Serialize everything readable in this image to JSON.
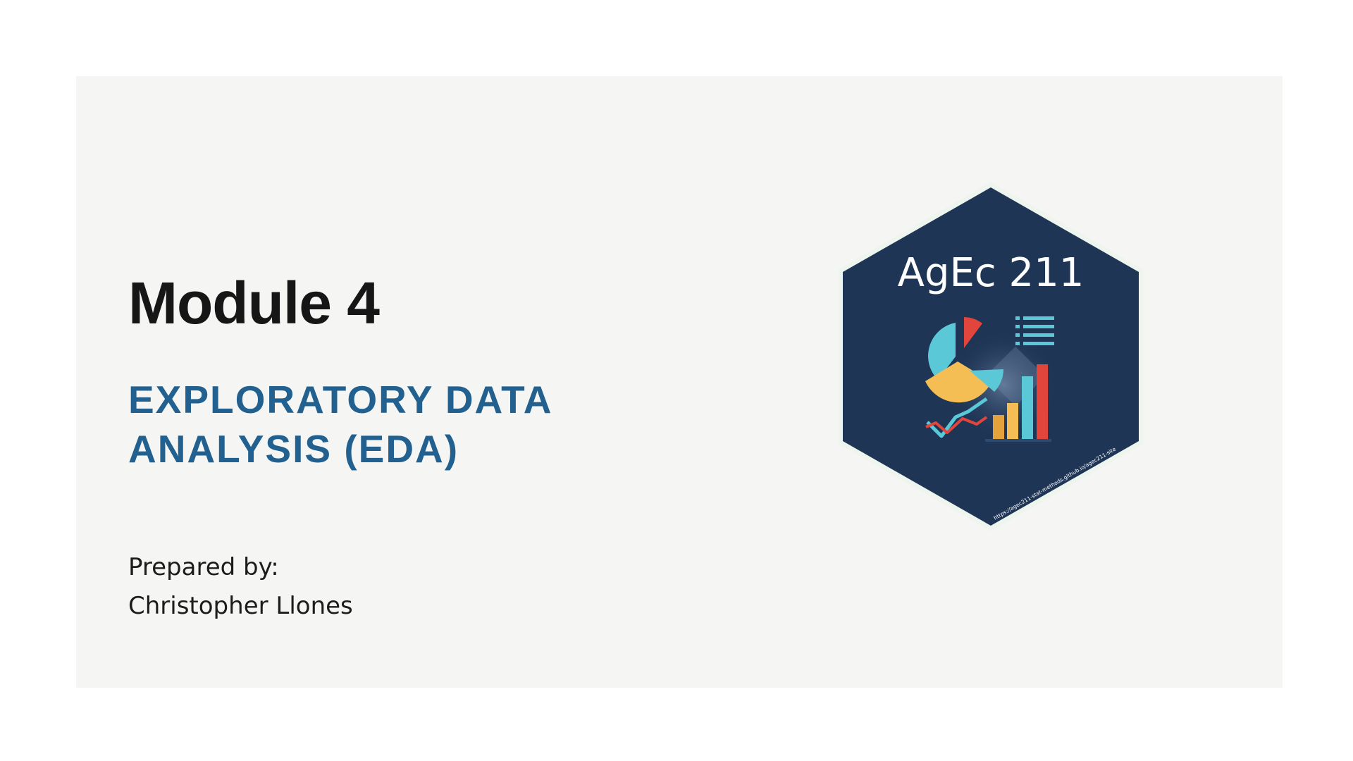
{
  "slide": {
    "title": "Module 4",
    "subtitle": "EXPLORATORY DATA ANALYSIS (EDA)",
    "prepared_label": "Prepared by:",
    "author": "Christopher Llones"
  },
  "logo": {
    "name": "AgEc 211",
    "url": "https://agec211-stat-methods.github.io/agec211-site",
    "icon": "data-analytics-icon",
    "colors": {
      "hex_fill": "#1f3556",
      "hex_border": "#eef4ee",
      "cyan": "#5bc8d8",
      "red": "#e2453c",
      "yellow": "#f5be55",
      "orange": "#e4a23c"
    }
  },
  "colors": {
    "background": "#ffffff",
    "panel": "#f5f6f4",
    "title": "#161616",
    "subtitle": "#22618f",
    "body_text": "#1c1c1c"
  }
}
